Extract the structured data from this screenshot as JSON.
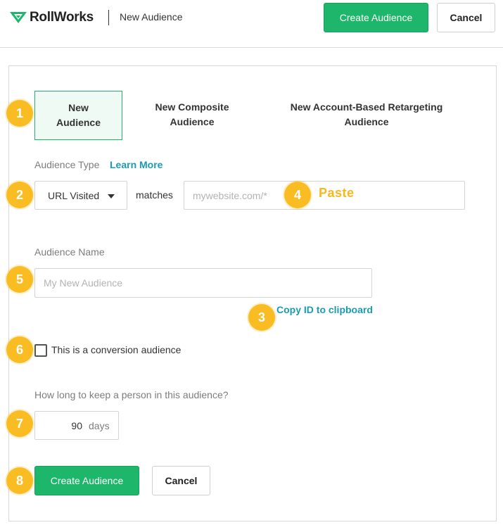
{
  "header": {
    "logo_text": "RollWorks",
    "page_title": "New Audience",
    "create_label": "Create Audience",
    "cancel_label": "Cancel"
  },
  "tabs": [
    {
      "label": "New Audience",
      "active": true
    },
    {
      "label": "New Composite Audience",
      "active": false
    },
    {
      "label": "New Account-Based Retargeting Audience",
      "active": false
    }
  ],
  "audience_type": {
    "label": "Audience Type",
    "learn_more": "Learn More",
    "select_value": "URL Visited",
    "matches_label": "matches",
    "url_placeholder": "mywebsite.com/*"
  },
  "paste_note": "Paste",
  "audience_name": {
    "label": "Audience Name",
    "placeholder": "My New Audience",
    "copy_link": "Copy ID to clipboard"
  },
  "conversion": {
    "label": "This is a conversion audience",
    "checked": false
  },
  "duration": {
    "label": "How long to keep a person in this audience?",
    "value": "90",
    "unit": "days"
  },
  "footer": {
    "create_label": "Create Audience",
    "cancel_label": "Cancel"
  },
  "badges": [
    "1",
    "2",
    "3",
    "4",
    "5",
    "6",
    "7",
    "8"
  ],
  "colors": {
    "brand_green": "#1db66a",
    "link_teal": "#1a9bb5",
    "badge_yellow": "#f9bd23"
  }
}
